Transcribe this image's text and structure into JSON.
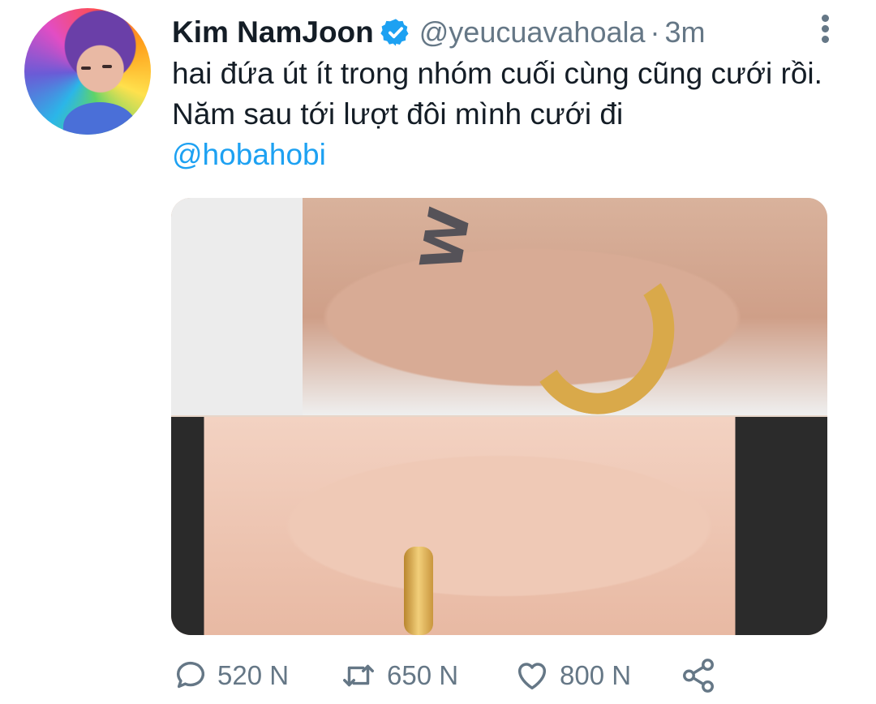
{
  "author": {
    "name": "Kim NamJoon",
    "handle": "@yeucuavahoala",
    "separator": "·",
    "time": "3m",
    "verified": true
  },
  "tweet": {
    "text": "hai đứa út ít trong nhóm cuối cùng cũng cưới rồi. Năm sau tới lượt đôi mình cưới đi",
    "mention": "@hobahobi"
  },
  "media": {
    "tattoo_top_letter": "W"
  },
  "actions": {
    "reply_count": "520 N",
    "retweet_count": "650 N",
    "like_count": "800 N"
  },
  "colors": {
    "accent": "#1da1f2",
    "text": "#141d26",
    "muted": "#657786"
  },
  "icons": [
    "verified-badge-icon",
    "more-icon",
    "reply-icon",
    "retweet-icon",
    "like-icon",
    "share-icon"
  ]
}
